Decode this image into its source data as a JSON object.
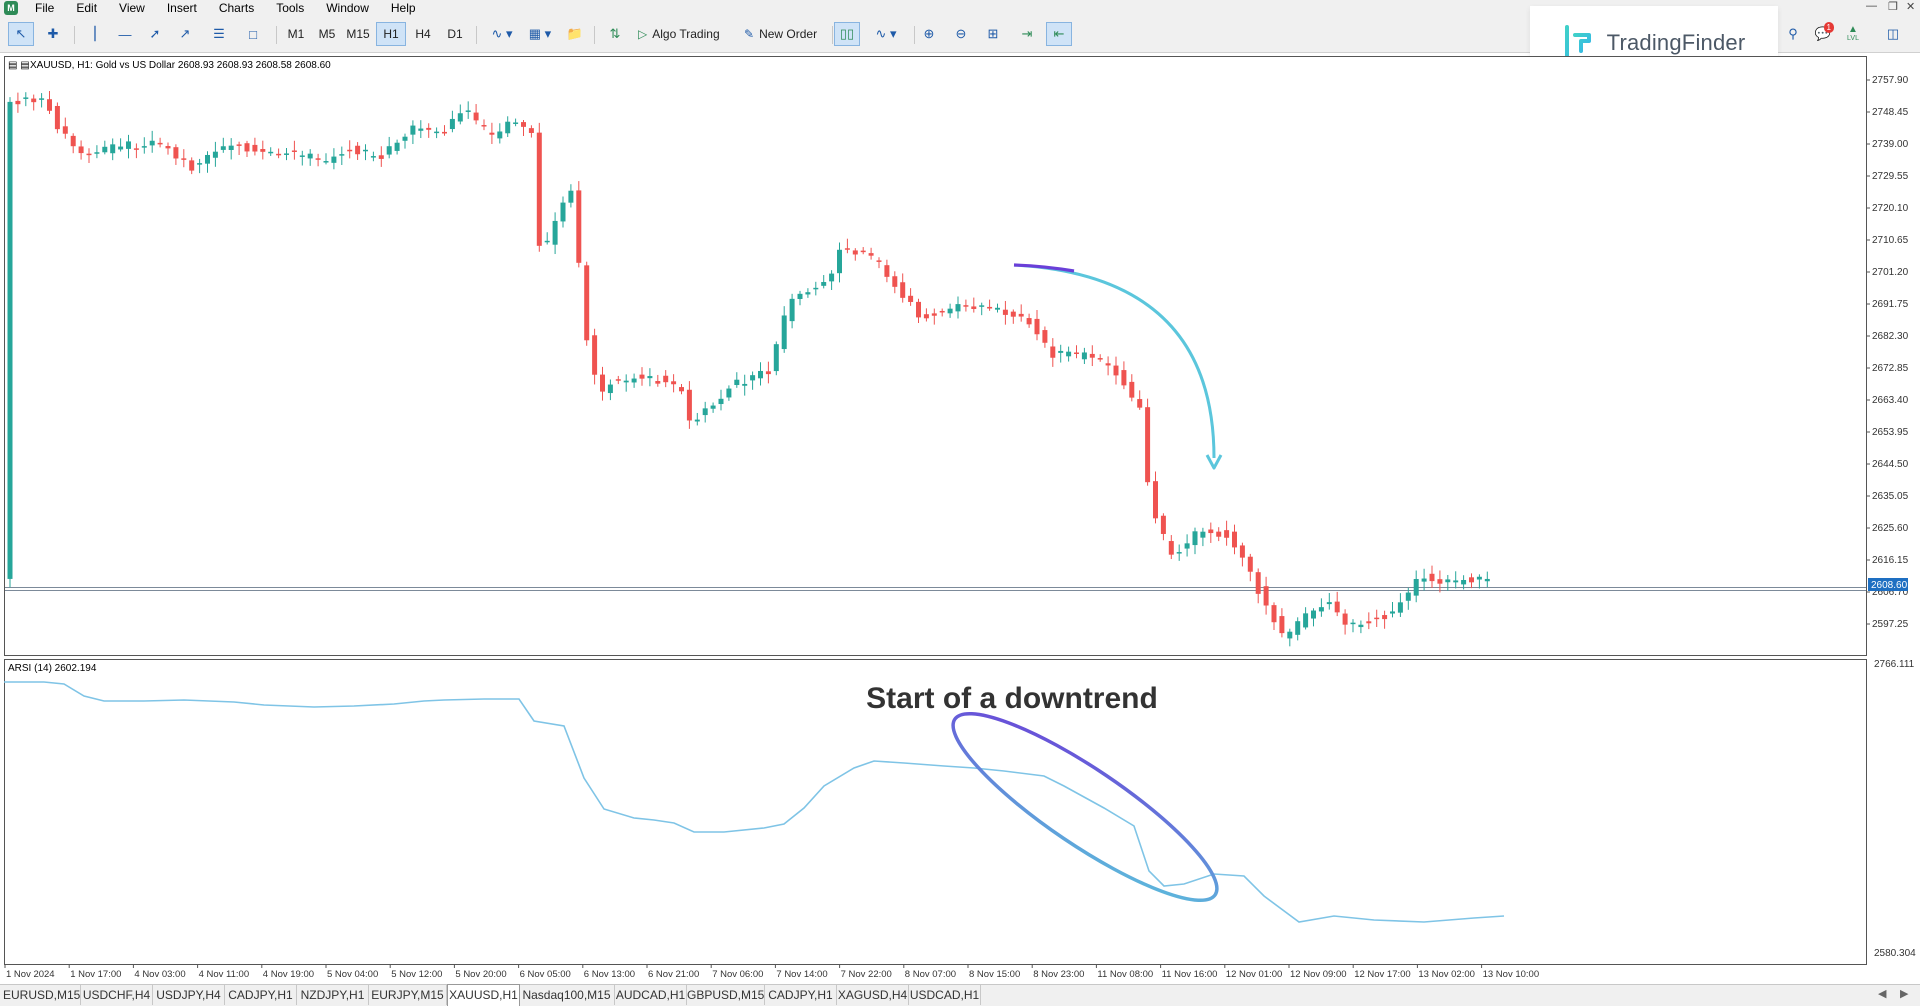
{
  "menu": {
    "items": [
      "File",
      "Edit",
      "View",
      "Insert",
      "Charts",
      "Tools",
      "Window",
      "Help"
    ]
  },
  "toolbar": {
    "timeframes": [
      "M1",
      "M5",
      "M15",
      "H1",
      "H4",
      "D1"
    ],
    "active_timeframe": "H1",
    "algo_trading_label": "Algo Trading",
    "new_order_label": "New Order",
    "notification_count": "1",
    "level_label": "LVL"
  },
  "logo": {
    "text": "TradingFinder"
  },
  "chart": {
    "symbol_info": "XAUUSD, H1:  Gold vs US Dollar  2608.93 2608.93 2608.58 2608.60",
    "price_labels": [
      "2757.90",
      "2748.45",
      "2739.00",
      "2729.55",
      "2720.10",
      "2710.65",
      "2701.20",
      "2691.75",
      "2682.30",
      "2672.85",
      "2663.40",
      "2653.95",
      "2644.50",
      "2635.05",
      "2625.60",
      "2616.15",
      "2606.70",
      "2597.25"
    ],
    "current_price": "2608.60",
    "annotation_text": "Start of a downtrend",
    "indicator_label": "ARSI (14) 2602.194",
    "indicator_max": "2766.111",
    "indicator_min": "2580.304",
    "time_labels": [
      "1 Nov 2024",
      "1 Nov 17:00",
      "4 Nov 03:00",
      "4 Nov 11:00",
      "4 Nov 19:00",
      "5 Nov 04:00",
      "5 Nov 12:00",
      "5 Nov 20:00",
      "6 Nov 05:00",
      "6 Nov 13:00",
      "6 Nov 21:00",
      "7 Nov 06:00",
      "7 Nov 14:00",
      "7 Nov 22:00",
      "8 Nov 07:00",
      "8 Nov 15:00",
      "8 Nov 23:00",
      "11 Nov 08:00",
      "11 Nov 16:00",
      "12 Nov 01:00",
      "12 Nov 09:00",
      "12 Nov 17:00",
      "13 Nov 02:00",
      "13 Nov 10:00"
    ],
    "colors": {
      "bull": "#26a69a",
      "bear": "#ef5350",
      "arrow": "#5bc6dc",
      "indicator": "#7fc4e6",
      "ellipse_start": "#6a3fd8",
      "ellipse_end": "#5bc6dc"
    }
  },
  "tabs": {
    "items": [
      "EURUSD,M15",
      "USDCHF,H4",
      "USDJPY,H4",
      "CADJPY,H1",
      "NZDJPY,H1",
      "EURJPY,M15",
      "XAUUSD,H1",
      "Nasdaq100,M15",
      "AUDCAD,H1",
      "GBPUSD,M15",
      "CADJPY,H1",
      "XAGUSD,H4",
      "USDCAD,H1"
    ],
    "active": "XAUUSD,H1"
  }
}
